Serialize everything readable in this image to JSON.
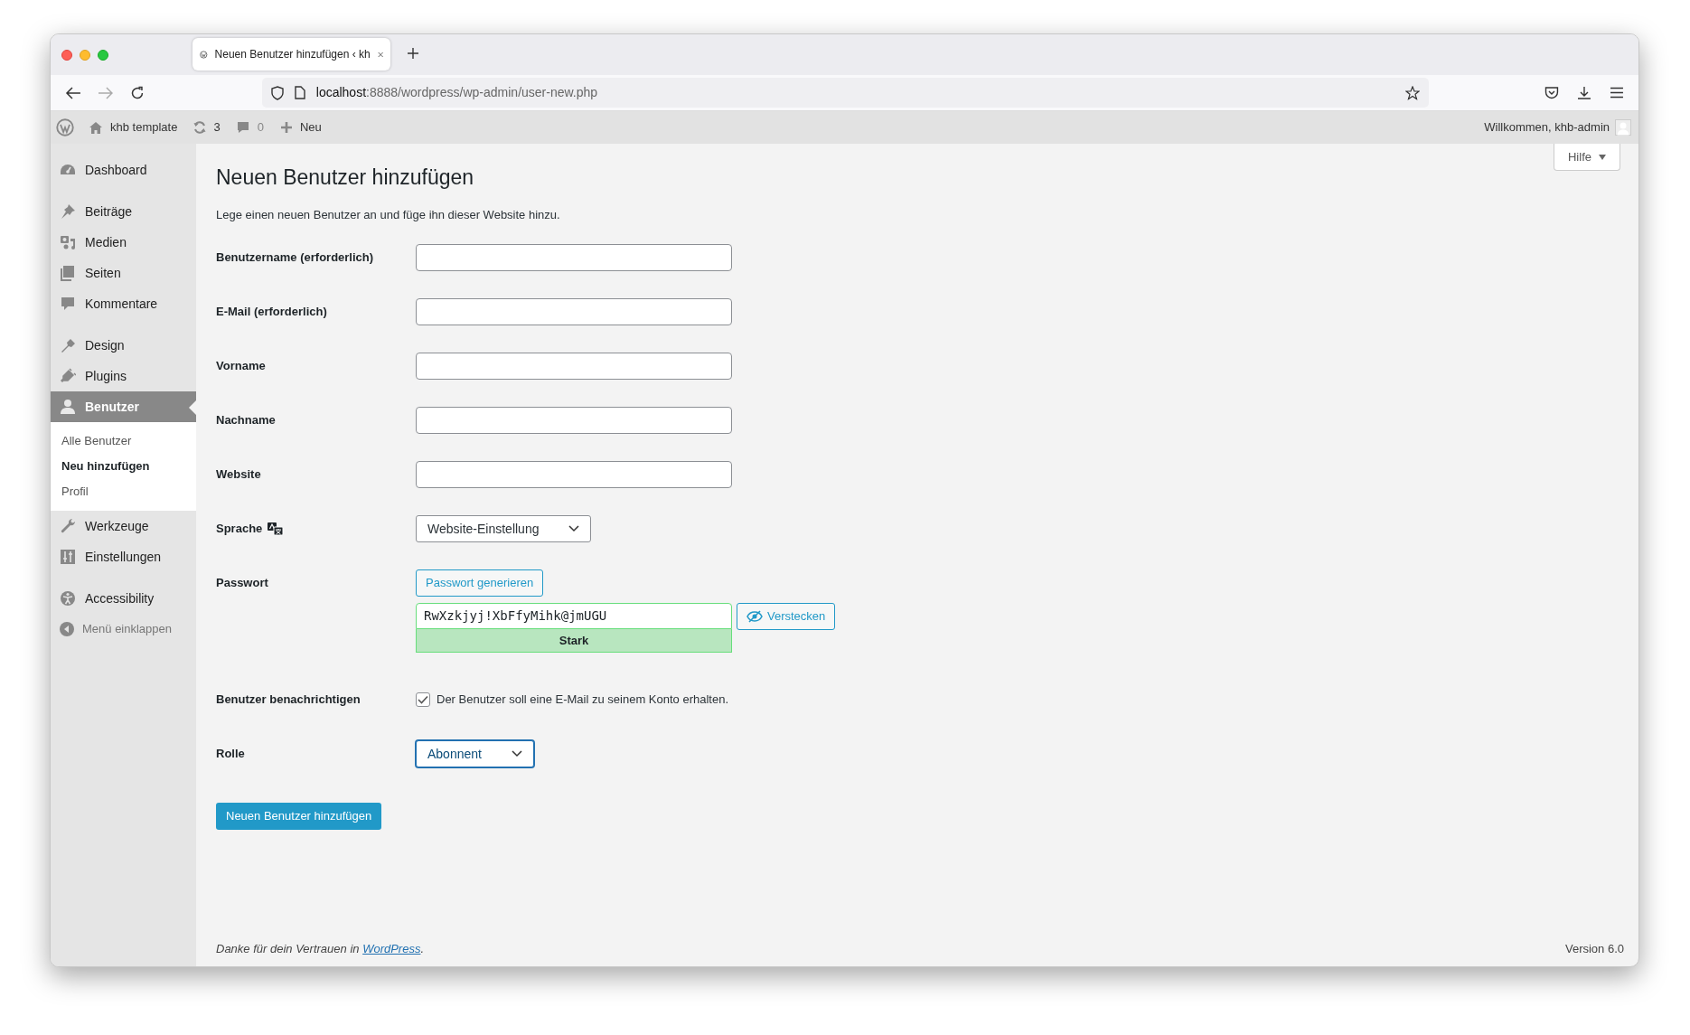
{
  "browser": {
    "tab": {
      "title": "Neuen Benutzer hinzufügen ‹ kh",
      "selected": true
    },
    "url": {
      "host": "localhost",
      "path": ":8888/wordpress/wp-admin/user-new.php"
    }
  },
  "admin_bar": {
    "site": "khb template",
    "updates": "3",
    "comments": "0",
    "new": "Neu",
    "greeting": "Willkommen, khb-admin"
  },
  "sidebar": {
    "groups": [
      {
        "items": [
          {
            "label": "Dashboard",
            "selected": false
          }
        ]
      },
      {
        "items": [
          {
            "label": "Beiträge",
            "selected": false
          },
          {
            "label": "Medien",
            "selected": false
          },
          {
            "label": "Seiten",
            "selected": false
          },
          {
            "label": "Kommentare",
            "selected": false
          }
        ]
      },
      {
        "items": [
          {
            "label": "Design",
            "selected": false
          },
          {
            "label": "Plugins",
            "selected": false
          },
          {
            "label": "Benutzer",
            "selected": true,
            "children": [
              {
                "label": "Alle Benutzer",
                "selected": false
              },
              {
                "label": "Neu hinzufügen",
                "selected": true
              },
              {
                "label": "Profil",
                "selected": false
              }
            ]
          },
          {
            "label": "Werkzeuge",
            "selected": false
          },
          {
            "label": "Einstellungen",
            "selected": false
          }
        ]
      },
      {
        "items": [
          {
            "label": "Accessibility",
            "selected": false
          }
        ]
      }
    ],
    "collapse_label": "Menü einklappen"
  },
  "help_button": "Hilfe",
  "page": {
    "title": "Neuen Benutzer hinzufügen",
    "description": "Lege einen neuen Benutzer an und füge ihn dieser Website hinzu.",
    "fields": [
      {
        "kind": "text",
        "label": "Benutzername (erforderlich)"
      },
      {
        "kind": "text",
        "label": "E-Mail (erforderlich)"
      },
      {
        "kind": "text",
        "label": "Vorname"
      },
      {
        "kind": "text",
        "label": "Nachname"
      },
      {
        "kind": "text",
        "label": "Website"
      },
      {
        "kind": "select",
        "label": "Sprache",
        "language_icon": true,
        "value": "Website-Einstellung",
        "focused": false
      },
      {
        "kind": "password",
        "label": "Passwort",
        "generate_button": "Passwort generieren",
        "value": "RwXzkjyj!XbFfyMihk@jmUGU",
        "toggle_button": "Verstecken",
        "strength": "Stark"
      },
      {
        "kind": "checkbox",
        "label": "Benutzer benachrichtigen",
        "checked": true,
        "text": "Der Benutzer soll eine E-Mail zu seinem Konto erhalten."
      },
      {
        "kind": "select",
        "label": "Rolle",
        "value": "Abonnent",
        "focused": true
      }
    ],
    "submit": "Neuen Benutzer hinzufügen"
  },
  "footer": {
    "thanks_before": "Danke für dein Vertrauen in ",
    "link": "WordPress",
    "thanks_after": ".",
    "version": "Version 6.0"
  }
}
